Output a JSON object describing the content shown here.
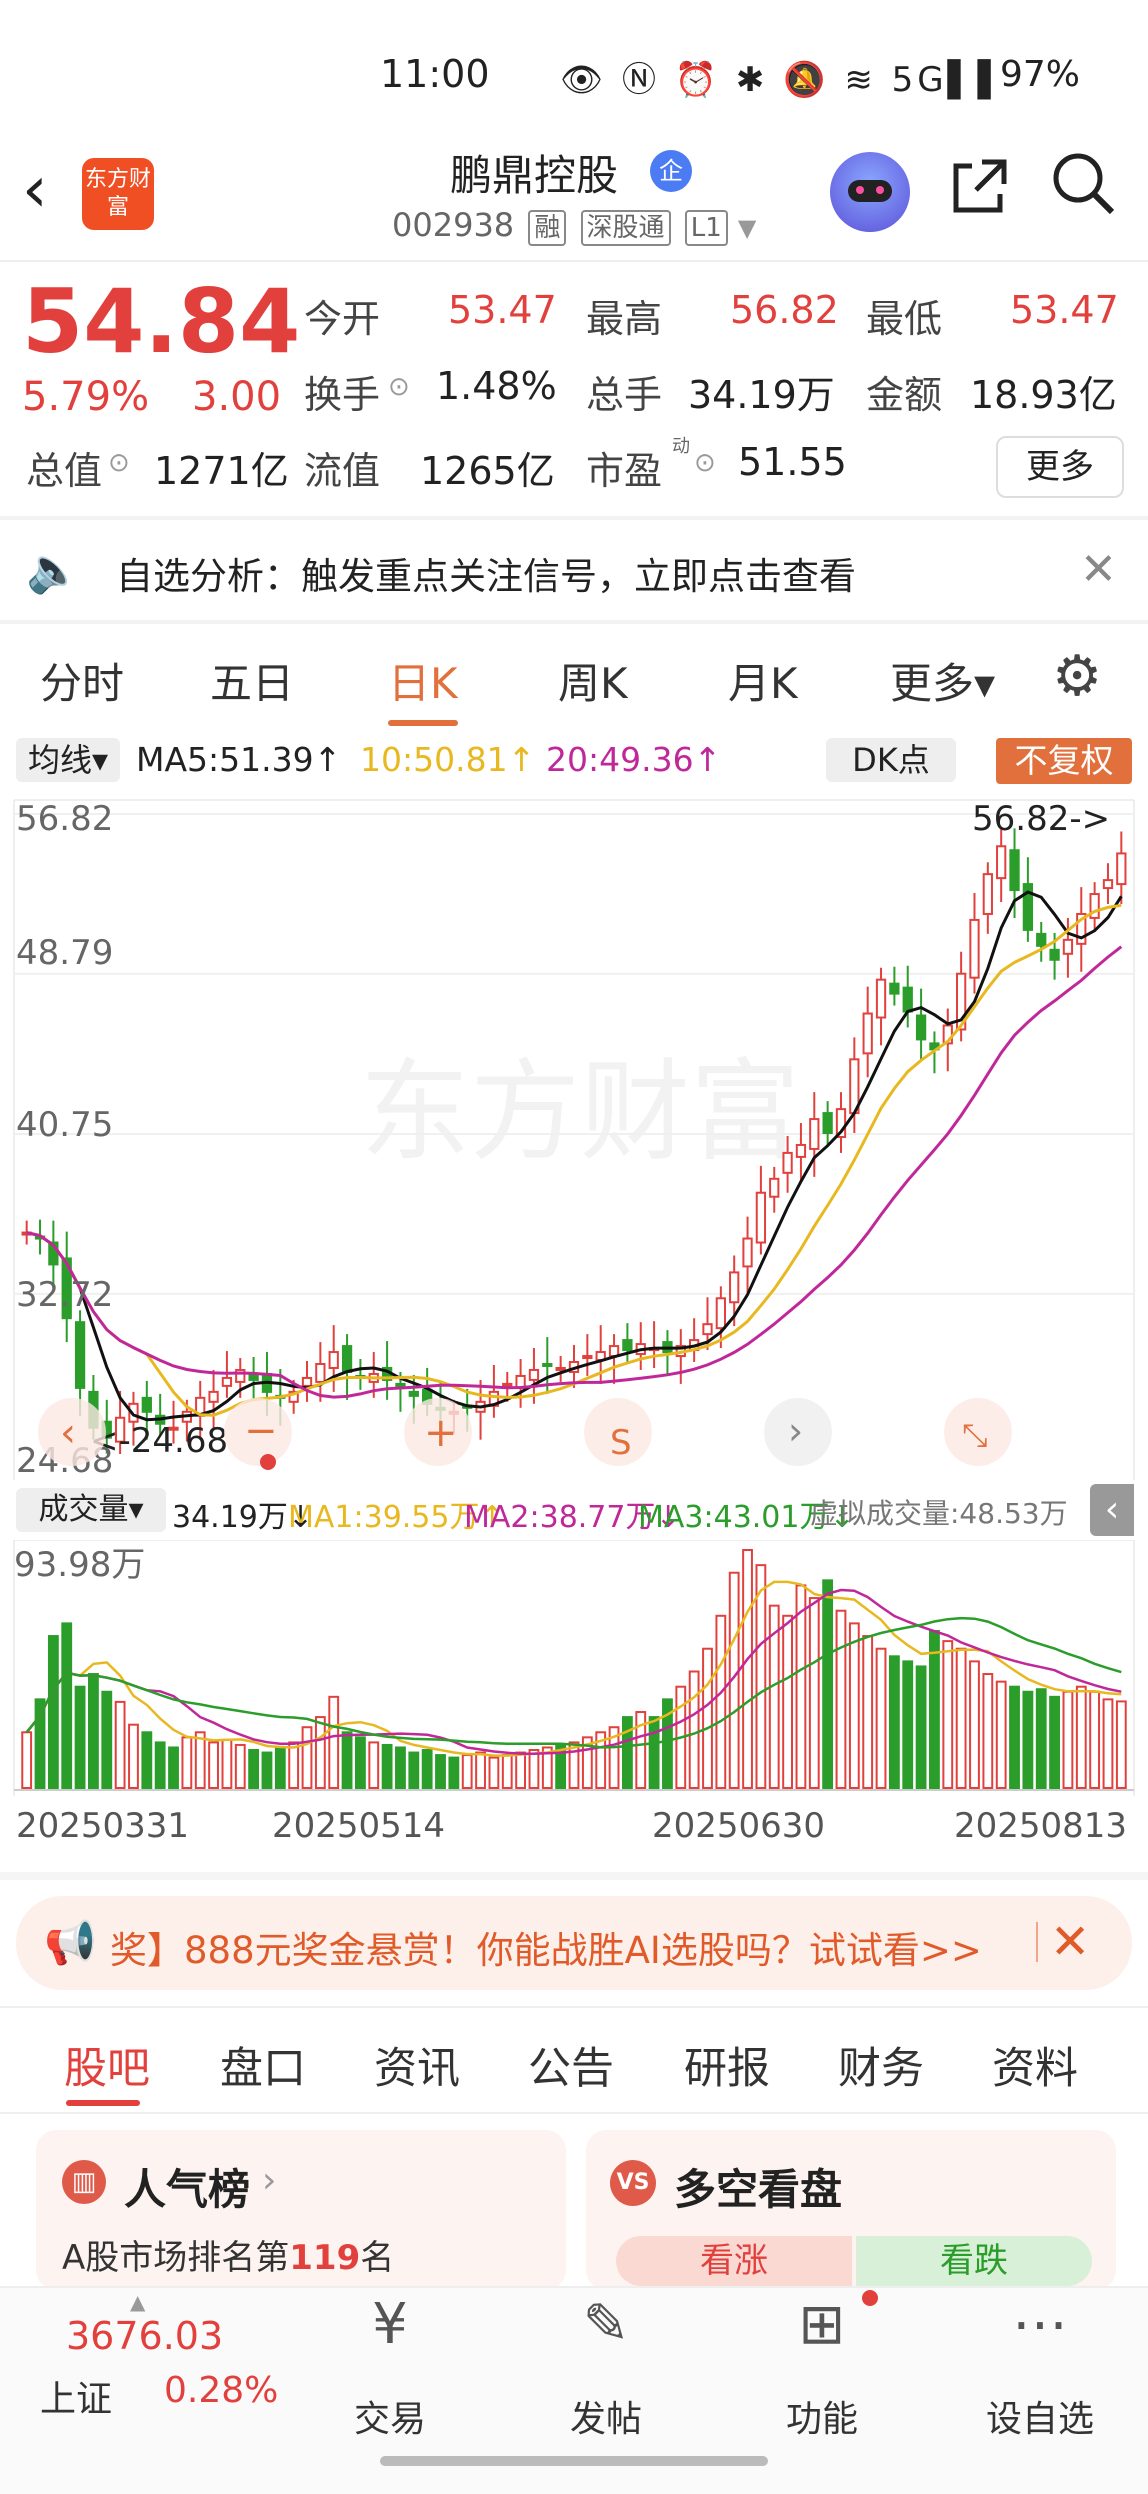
{
  "status_bar": {
    "time": "11:00",
    "icons": "👁 Ⓝ ⏰ ✱ 🔕 ≋ 5G▌▌",
    "battery": "97%"
  },
  "header": {
    "back_icon": "back-chevron",
    "logo_text": "东方财富",
    "stock_name": "鹏鼎控股",
    "qi_badge": "企",
    "stock_code": "002938",
    "tags": [
      "融",
      "深股通",
      "L1"
    ]
  },
  "quote": {
    "price": "54.84",
    "change_pct": "5.79%",
    "change": "3.00",
    "open_label": "今开",
    "open": "53.47",
    "high_label": "最高",
    "high": "56.82",
    "low_label": "最低",
    "low": "53.47",
    "turnover_label": "换手",
    "turnover": "1.48%",
    "volume_label": "总手",
    "volume": "34.19万",
    "amount_label": "金额",
    "amount": "18.93亿",
    "mktcap_label": "总值",
    "mktcap": "1271亿",
    "float_label": "流值",
    "float": "1265亿",
    "pe_label": "市盈",
    "pe_sup": "动",
    "pe": "51.55",
    "more_button": "更多"
  },
  "alert": {
    "text": "自选分析：触发重点关注信号，立即点击查看"
  },
  "chart_tabs": [
    "分时",
    "五日",
    "日K",
    "周K",
    "月K",
    "更多▾"
  ],
  "active_chart_tab": "日K",
  "ma_bar": {
    "selector": "均线▾",
    "ma5": "MA5:51.39↑",
    "ma10": "10:50.81↑",
    "ma20": "20:49.36↑",
    "dk": "DK点",
    "adjust": "不复权"
  },
  "kline": {
    "y_labels": [
      "56.82",
      "48.79",
      "40.75",
      "32.72",
      "24.68"
    ],
    "high_annot": "56.82->",
    "low_annot": "<-24.68",
    "watermark": "东方财富"
  },
  "volume_bar": {
    "selector": "成交量▾",
    "vol": "34.19万↓",
    "ma1": "MA1:39.55万↑",
    "ma2": "MA2:38.77万↓",
    "ma3": "MA3:43.01万↓",
    "virtual": "虚拟成交量:48.53万",
    "max_label": "93.98万"
  },
  "dates": [
    "20250331",
    "20250514",
    "20250630",
    "20250813"
  ],
  "banner": {
    "text": "奖】888元奖金悬赏！你能战胜AI选股吗？试试看>>"
  },
  "lower_tabs": [
    "股吧",
    "盘口",
    "资讯",
    "公告",
    "研报",
    "财务",
    "资料"
  ],
  "cards": {
    "popularity_title": "人气榜",
    "popularity_text": "A股市场排名第",
    "popularity_rank": "119",
    "popularity_suffix": "名",
    "duokong_title": "多空看盘",
    "up_label": "看涨",
    "down_label": "看跌"
  },
  "bottom_nav": {
    "index_value": "3676.03",
    "index_name": "上证",
    "index_pct": "0.28%",
    "items": [
      "交易",
      "发帖",
      "功能",
      "设自选"
    ]
  },
  "colors": {
    "up": "#e2403d",
    "down": "#2a9d2a",
    "accent": "#e2703d",
    "ma5": "#111111",
    "ma10": "#e8b820",
    "ma20": "#c0289a"
  },
  "chart_data": {
    "type": "candlestick",
    "y_range": [
      24.68,
      56.82
    ],
    "ma_lines": [
      "MA5",
      "MA10",
      "MA20"
    ],
    "closes": [
      35.8,
      35.5,
      34.2,
      31.5,
      28.0,
      26.0,
      25.5,
      26.5,
      27.2,
      26.8,
      26.2,
      26.0,
      26.8,
      27.5,
      27.8,
      28.5,
      28.9,
      28.4,
      27.8,
      27.5,
      27.8,
      28.5,
      29.2,
      29.8,
      28.8,
      28.5,
      28.7,
      28.4,
      28.0,
      27.6,
      27.2,
      26.9,
      26.8,
      27.0,
      27.3,
      27.8,
      28.2,
      28.6,
      28.9,
      29.1,
      29.0,
      29.3,
      29.6,
      29.8,
      30.1,
      29.9,
      30.2,
      30.0,
      29.8,
      30.1,
      30.4,
      31.2,
      32.5,
      33.8,
      35.5,
      37.8,
      38.5,
      39.8,
      40.2,
      41.5,
      40.8,
      42.0,
      44.5,
      46.8,
      48.5,
      47.8,
      46.9,
      45.5,
      45.0,
      46.2,
      48.8,
      51.5,
      53.8,
      55.2,
      53.0,
      51.0,
      50.2,
      49.5,
      50.5,
      51.8,
      52.8,
      53.5,
      54.84
    ],
    "volumes_wan": [
      22,
      35,
      60,
      65,
      40,
      45,
      38,
      34,
      25,
      22,
      18,
      16,
      20,
      22,
      18,
      19,
      17,
      15,
      14,
      16,
      18,
      24,
      28,
      36,
      22,
      20,
      18,
      17,
      16,
      14,
      15,
      13,
      12,
      13,
      14,
      12,
      13,
      14,
      15,
      16,
      17,
      18,
      20,
      22,
      24,
      28,
      30,
      28,
      35,
      40,
      46,
      55,
      68,
      85,
      93.98,
      88,
      72,
      68,
      80,
      75,
      82,
      70,
      65,
      60,
      55,
      52,
      50,
      48,
      62,
      58,
      55,
      50,
      45,
      42,
      40,
      38,
      39,
      36,
      38,
      40,
      38,
      35,
      34.19
    ]
  }
}
